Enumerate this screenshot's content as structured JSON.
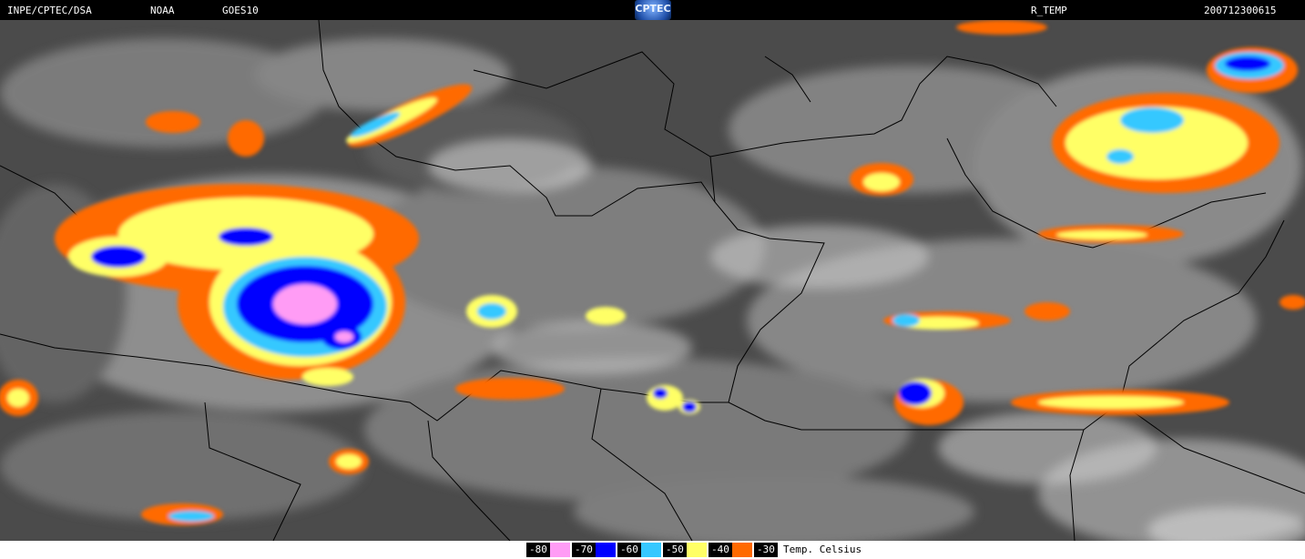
{
  "header": {
    "left_label": "INPE/CPTEC/DSA",
    "agency": "NOAA",
    "satellite": "GOES10",
    "logo_text": "CPTEC",
    "product": "R_TEMP",
    "timestamp": "200712300615"
  },
  "legend": {
    "unit_label": "Temp. Celsius",
    "items": [
      {
        "label": "-80",
        "color": "#ff9cf5"
      },
      {
        "label": "-70",
        "color": "#0000ff"
      },
      {
        "label": "-60",
        "color": "#36c8ff"
      },
      {
        "label": "-50",
        "color": "#ffff66"
      },
      {
        "label": "-40",
        "color": "#ff6a00"
      },
      {
        "label": "-30",
        "color": ""
      }
    ]
  },
  "map": {
    "background_color": "#4b4b4b",
    "cloud_color": "#c8c8c8",
    "border_color": "#000000"
  }
}
